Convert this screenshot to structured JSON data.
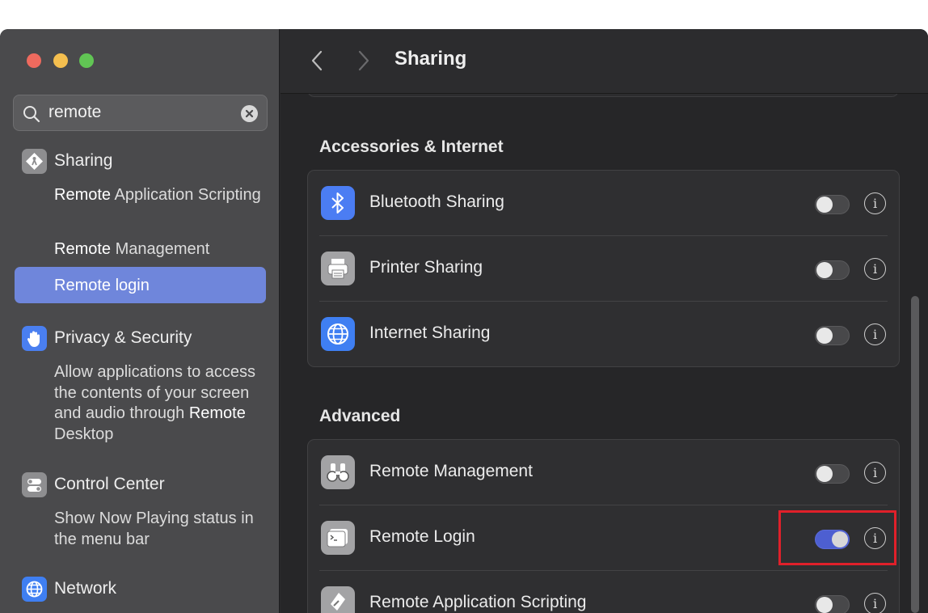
{
  "search": {
    "value": "remote"
  },
  "sidebar": {
    "sharing": {
      "label": "Sharing",
      "sub1_strong": "Remote",
      "sub1_rest": " Application Scripting",
      "sub2_strong": "Remote",
      "sub2_rest": " Management",
      "sub3_strong": "Remote",
      "sub3_rest": " login"
    },
    "privacy": {
      "label": "Privacy & Security",
      "sub_text": "Allow applications to access the contents of your screen and audio through ",
      "sub_strong": "Remote",
      "sub_rest": " Desktop"
    },
    "control_center": {
      "label": "Control Center",
      "sub": "Show Now Playing status in the menu bar"
    },
    "network": {
      "label": "Network"
    }
  },
  "header": {
    "title": "Sharing"
  },
  "sections": {
    "accessories": {
      "title": "Accessories & Internet",
      "rows": [
        {
          "label": "Bluetooth Sharing",
          "enabled": false,
          "icon": "bluetooth-icon"
        },
        {
          "label": "Printer Sharing",
          "enabled": false,
          "icon": "printer-icon"
        },
        {
          "label": "Internet Sharing",
          "enabled": false,
          "icon": "globe-icon"
        }
      ]
    },
    "advanced": {
      "title": "Advanced",
      "rows": [
        {
          "label": "Remote Management",
          "enabled": false,
          "icon": "binoculars-icon"
        },
        {
          "label": "Remote Login",
          "enabled": true,
          "icon": "terminal-icon"
        },
        {
          "label": "Remote Application Scripting",
          "enabled": false,
          "icon": "script-icon"
        }
      ]
    }
  },
  "colors": {
    "accent": "#6f86db",
    "toggle_on": "#4d5fd1",
    "highlight": "#e0202a"
  }
}
